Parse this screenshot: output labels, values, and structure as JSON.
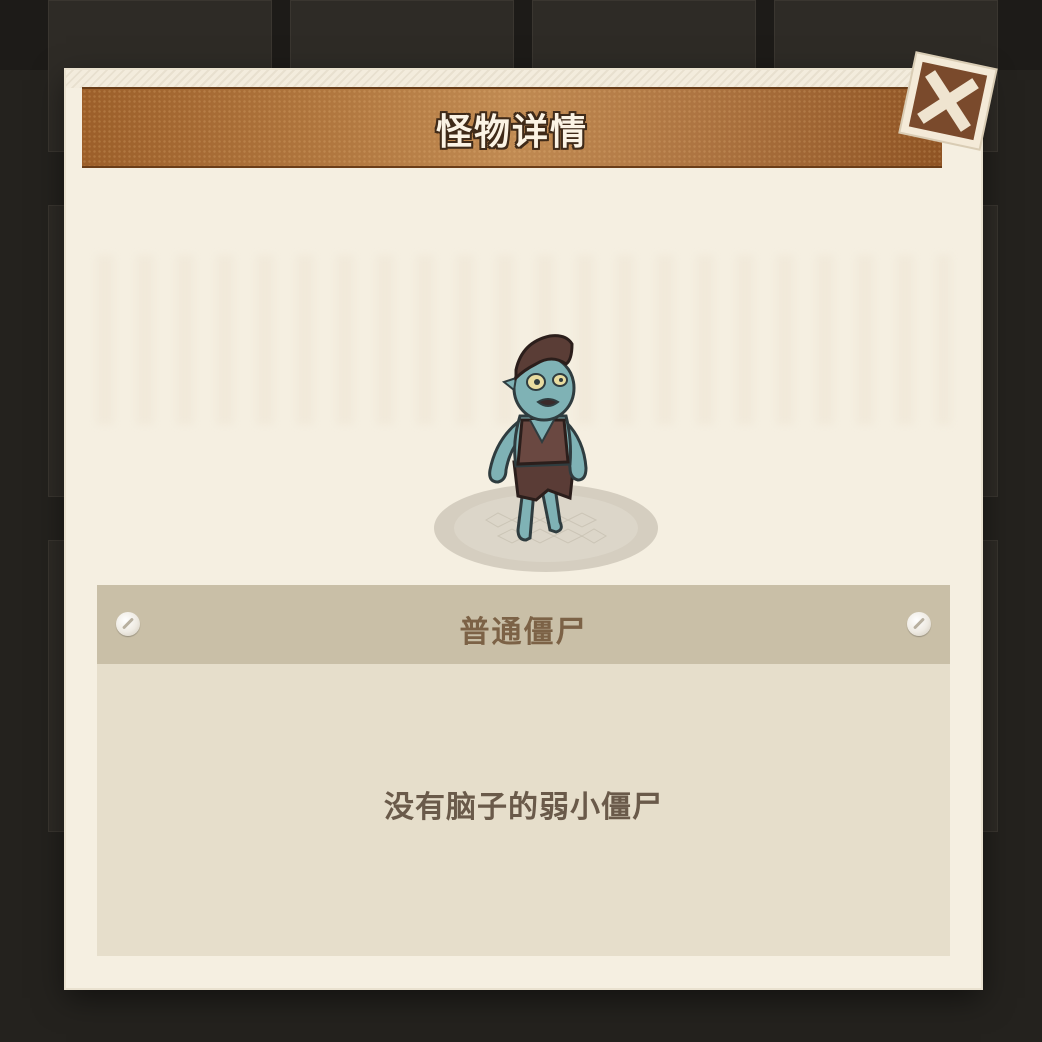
{
  "dialog": {
    "title": "怪物详情",
    "close_icon": "close-x-icon"
  },
  "monster": {
    "name": "普通僵尸",
    "description": "没有脑子的弱小僵尸"
  },
  "colors": {
    "banner": "#b0763e",
    "panel": "#f5efe1",
    "name_bar": "#c9bfa7",
    "desc_panel": "#e6decb",
    "zombie_skin": "#7fb2b5"
  }
}
